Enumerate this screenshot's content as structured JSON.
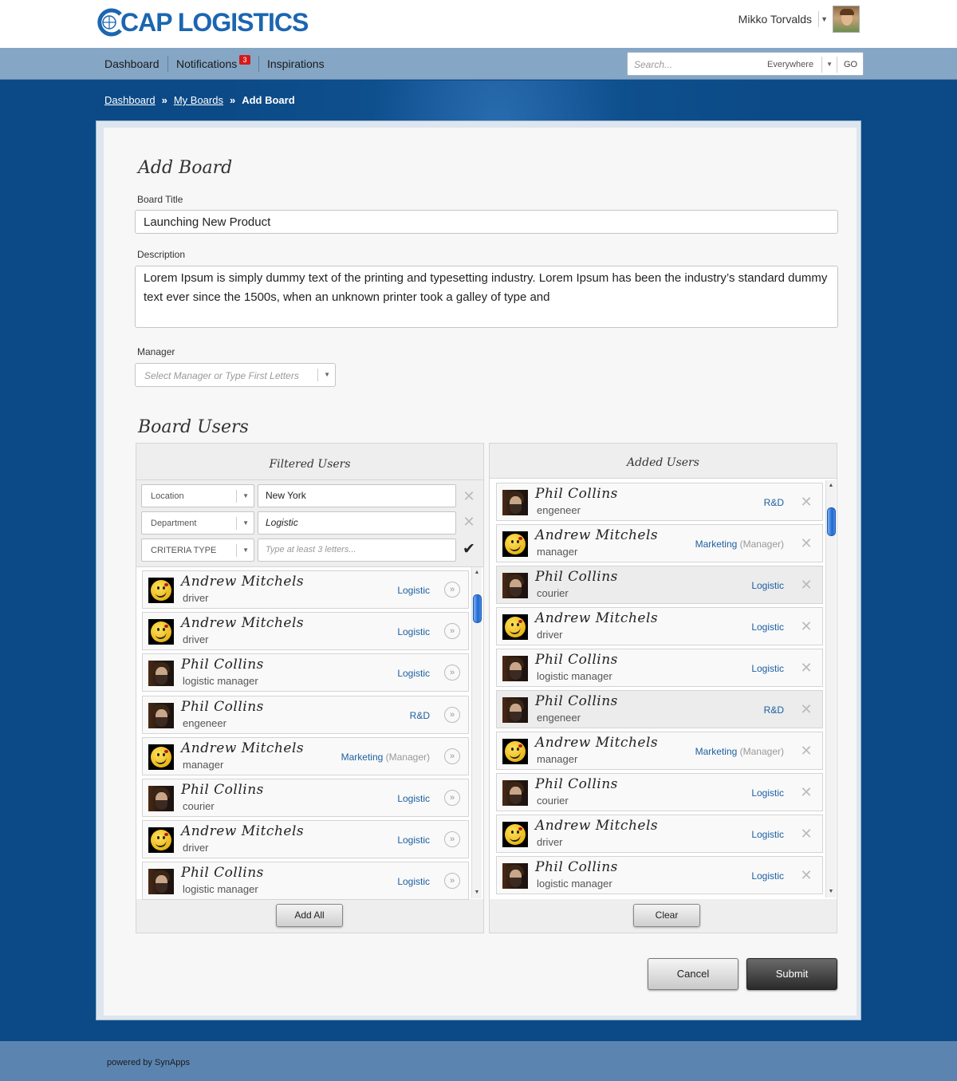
{
  "header": {
    "logo_text": "CAP LOGISTICS",
    "user_name": "Mikko Torvalds",
    "icons": {
      "avatar": "user-avatar",
      "caret": "chevron-down-icon"
    }
  },
  "nav": {
    "items": [
      {
        "label": "Dashboard"
      },
      {
        "label": "Notifications",
        "badge": "3"
      },
      {
        "label": "Inspirations"
      }
    ],
    "search": {
      "placeholder": "Search...",
      "scope": "Everywhere",
      "go_label": "GO"
    }
  },
  "breadcrumb": {
    "items": [
      "Dashboard",
      "My Boards"
    ],
    "current": "Add Board",
    "separator": "»"
  },
  "form": {
    "heading": "Add Board",
    "title_label": "Board Title",
    "title_value": "Launching New Product",
    "description_label": "Description",
    "description_value": "Lorem Ipsum is simply dummy text of the printing and typesetting industry. Lorem Ipsum has been the industry’s standard dummy text ever since the 1500s, when an unknown printer took a galley of type and",
    "manager_label": "Manager",
    "manager_placeholder": "Select Manager or Type First Letters"
  },
  "board_users": {
    "heading": "Board Users",
    "filtered": {
      "title": "Filtered Users",
      "filters": [
        {
          "criteria": "Location",
          "value": "New York",
          "value_italic": false,
          "action": "clear"
        },
        {
          "criteria": "Department",
          "value": "Logistic",
          "value_italic": true,
          "action": "clear"
        },
        {
          "criteria": "CRITERIA TYPE",
          "value": "",
          "placeholder": "Type at least 3 letters...",
          "action": "confirm"
        }
      ],
      "users": [
        {
          "name": "Andrew Mitchels",
          "role": "driver",
          "dept": "Logistic",
          "mgr": "",
          "photo": "smiley"
        },
        {
          "name": "Andrew Mitchels",
          "role": "driver",
          "dept": "Logistic",
          "mgr": "",
          "photo": "smiley"
        },
        {
          "name": "Phil Collins",
          "role": "logistic manager",
          "dept": "Logistic",
          "mgr": "",
          "photo": "phil"
        },
        {
          "name": "Phil Collins",
          "role": "engeneer",
          "dept": "R&D",
          "mgr": "",
          "photo": "phil"
        },
        {
          "name": "Andrew Mitchels",
          "role": "manager",
          "dept": "Marketing",
          "mgr": "(Manager)",
          "photo": "smiley"
        },
        {
          "name": "Phil Collins",
          "role": "courier",
          "dept": "Logistic",
          "mgr": "",
          "photo": "phil"
        },
        {
          "name": "Andrew Mitchels",
          "role": "driver",
          "dept": "Logistic",
          "mgr": "",
          "photo": "smiley"
        },
        {
          "name": "Phil Collins",
          "role": "logistic manager",
          "dept": "Logistic",
          "mgr": "",
          "photo": "phil"
        }
      ],
      "button_label": "Add All"
    },
    "added": {
      "title": "Added Users",
      "users": [
        {
          "name": "Phil Collins",
          "role": "engeneer",
          "dept": "R&D",
          "mgr": "",
          "photo": "phil",
          "highlight": false
        },
        {
          "name": "Andrew Mitchels",
          "role": "manager",
          "dept": "Marketing",
          "mgr": "(Manager)",
          "photo": "smiley",
          "highlight": false
        },
        {
          "name": "Phil Collins",
          "role": "courier",
          "dept": "Logistic",
          "mgr": "",
          "photo": "phil",
          "highlight": true
        },
        {
          "name": "Andrew Mitchels",
          "role": "driver",
          "dept": "Logistic",
          "mgr": "",
          "photo": "smiley",
          "highlight": false
        },
        {
          "name": "Phil Collins",
          "role": "logistic manager",
          "dept": "Logistic",
          "mgr": "",
          "photo": "phil",
          "highlight": false
        },
        {
          "name": "Phil Collins",
          "role": "engeneer",
          "dept": "R&D",
          "mgr": "",
          "photo": "phil",
          "highlight": true
        },
        {
          "name": "Andrew Mitchels",
          "role": "manager",
          "dept": "Marketing",
          "mgr": "(Manager)",
          "photo": "smiley",
          "highlight": false
        },
        {
          "name": "Phil Collins",
          "role": "courier",
          "dept": "Logistic",
          "mgr": "",
          "photo": "phil",
          "highlight": false
        },
        {
          "name": "Andrew Mitchels",
          "role": "driver",
          "dept": "Logistic",
          "mgr": "",
          "photo": "smiley",
          "highlight": false
        },
        {
          "name": "Phil Collins",
          "role": "logistic manager",
          "dept": "Logistic",
          "mgr": "",
          "photo": "phil",
          "highlight": false
        }
      ],
      "button_label": "Clear"
    }
  },
  "actions": {
    "cancel_label": "Cancel",
    "submit_label": "Submit"
  },
  "footer": {
    "text": "powered by SynApps"
  },
  "colors": {
    "brand": "#1b66b1",
    "nav_bg": "#86a6c5",
    "page_bg": "#0b4a86",
    "link_dept": "#1d5fa1",
    "badge": "#d21a1a"
  }
}
